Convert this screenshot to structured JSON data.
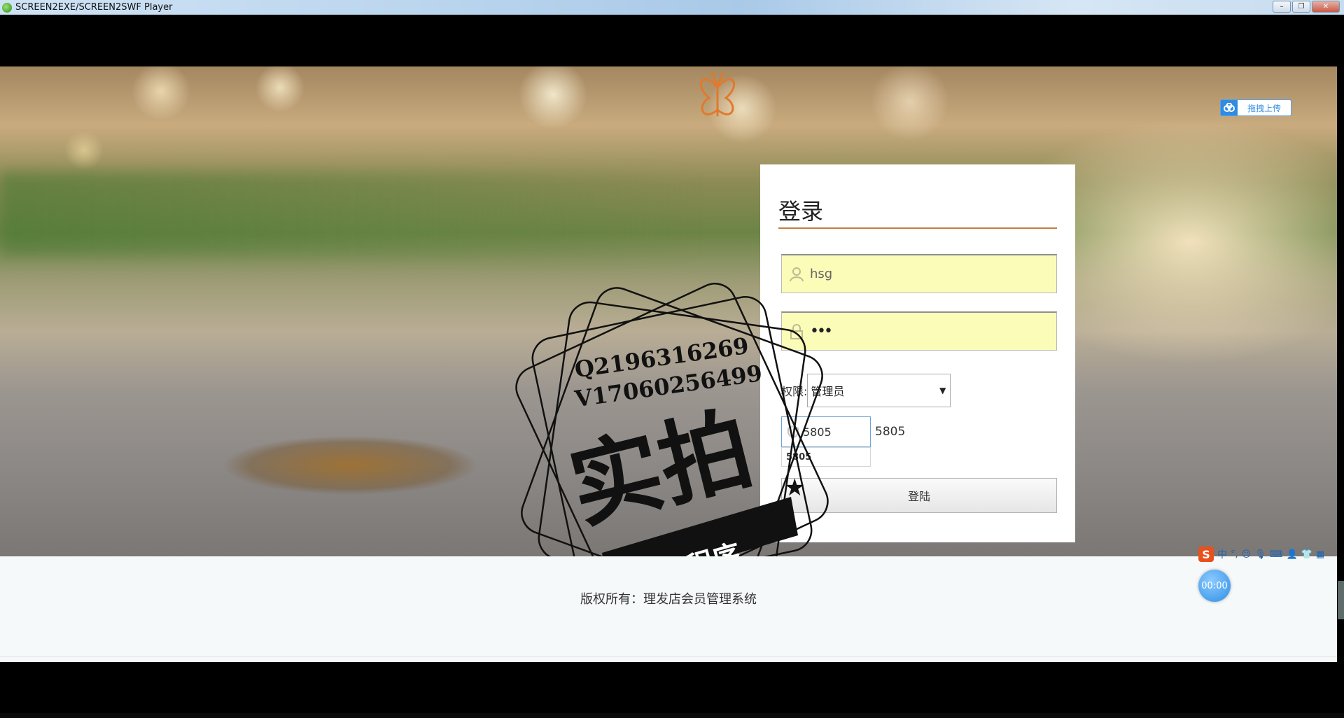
{
  "window": {
    "title": "SCREEN2EXE/SCREEN2SWF Player",
    "minimize_label": "–",
    "restore_label": "❐",
    "close_label": "✕"
  },
  "page": {
    "upload_button": "拖拽上传",
    "login": {
      "title": "登录",
      "username_value": "hsg",
      "password_value": "•••",
      "role_label": "权限:",
      "role_selected": "管理员",
      "captcha_input_value": "5805",
      "captcha_code": "5805",
      "captcha_suggestion": "5805",
      "submit_label": "登陆"
    },
    "footer": {
      "copyright": "版权所有：理发店会员管理系统"
    }
  },
  "watermark": {
    "qq": "Q2196316269",
    "wx": "V17060256499",
    "main": "实拍",
    "banner": "全微程序"
  },
  "ime": {
    "logo": "S",
    "mode": "中",
    "punct": "°,"
  },
  "recorder": {
    "timer": "00:00"
  },
  "colors": {
    "accent_orange": "#c87c3c",
    "input_fill": "#fcfcb9",
    "upload_blue": "#2f8ce0"
  }
}
